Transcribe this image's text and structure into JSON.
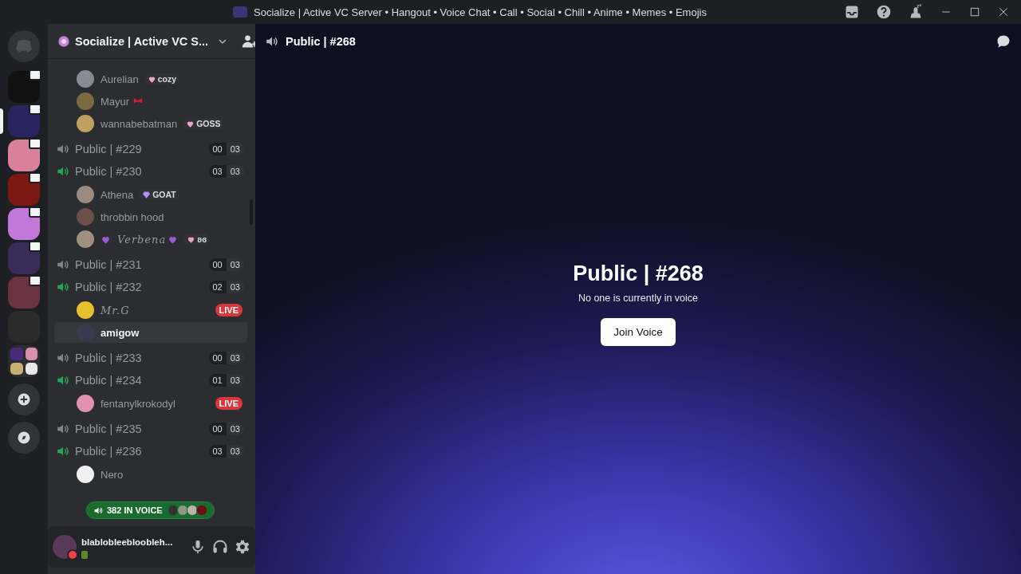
{
  "window": {
    "title": "Socialize | Active VC Server • Hangout • Voice Chat • Call • Social • Chill • Anime • Memes • Emojis"
  },
  "server_rail": {
    "servers": [
      {
        "kind": "server",
        "selected": false,
        "streaming": true
      },
      {
        "kind": "server",
        "selected": true,
        "streaming": true
      },
      {
        "kind": "server",
        "selected": false,
        "streaming": true
      },
      {
        "kind": "server",
        "selected": false,
        "streaming": true
      },
      {
        "kind": "server",
        "selected": false,
        "streaming": true
      },
      {
        "kind": "server",
        "selected": false,
        "streaming": true
      },
      {
        "kind": "server",
        "selected": false,
        "streaming": true
      },
      {
        "kind": "server",
        "selected": false,
        "streaming": false
      },
      {
        "kind": "folder",
        "selected": false,
        "streaming": false
      }
    ]
  },
  "sidebar": {
    "server_name": "Socialize | Active VC S...",
    "leading_members": [
      {
        "name": "Aurelian",
        "kind": "plain",
        "tag": {
          "kind": "heart",
          "text": "cozy"
        },
        "live": false,
        "selected": false
      },
      {
        "name": "Mayur",
        "kind": "bow",
        "live": false,
        "selected": false
      },
      {
        "name": "wannabebatman",
        "kind": "plain",
        "tag": {
          "kind": "heart",
          "text": "GOSS"
        },
        "live": false,
        "selected": false
      }
    ],
    "channels": [
      {
        "name": "Public | #229",
        "occupied": false,
        "count": "00",
        "limit": "03"
      },
      {
        "name": "Public | #230",
        "occupied": true,
        "count": "03",
        "limit": "03",
        "members": [
          {
            "name": "Athena",
            "kind": "plain",
            "tag": {
              "kind": "gem",
              "text": "GOAT"
            },
            "live": false,
            "selected": false
          },
          {
            "name": "throbbin hood",
            "kind": "plain",
            "live": false,
            "selected": false
          },
          {
            "name": "Verbena",
            "kind": "framed",
            "tag": {
              "kind": "heart",
              "text": "ʚɞ"
            },
            "live": false,
            "selected": false
          }
        ]
      },
      {
        "name": "Public | #231",
        "occupied": false,
        "count": "00",
        "limit": "03"
      },
      {
        "name": "Public | #232",
        "occupied": true,
        "count": "02",
        "limit": "03",
        "members": [
          {
            "name": "Mr.G",
            "kind": "script",
            "live": true,
            "live_text": "LIVE",
            "selected": false
          },
          {
            "name": "amigow",
            "kind": "plain",
            "live": false,
            "selected": true
          }
        ]
      },
      {
        "name": "Public | #233",
        "occupied": false,
        "count": "00",
        "limit": "03"
      },
      {
        "name": "Public | #234",
        "occupied": true,
        "count": "01",
        "limit": "03",
        "members": [
          {
            "name": "fentanylkrokodyl",
            "kind": "plain",
            "live": true,
            "live_text": "LIVE",
            "selected": false
          }
        ]
      },
      {
        "name": "Public | #235",
        "occupied": false,
        "count": "00",
        "limit": "03"
      },
      {
        "name": "Public | #236",
        "occupied": true,
        "count": "03",
        "limit": "03",
        "members": [
          {
            "name": "Nero",
            "kind": "plain",
            "live": false,
            "selected": false
          }
        ]
      }
    ],
    "voice_pill": {
      "text": "382 IN VOICE"
    }
  },
  "user_panel": {
    "username": "blablobleebloobleh...",
    "do_not_disturb": true
  },
  "main": {
    "header_title": "Public | #268",
    "title": "Public | #268",
    "subtitle": "No one is currently in voice",
    "join_button": "Join Voice"
  }
}
